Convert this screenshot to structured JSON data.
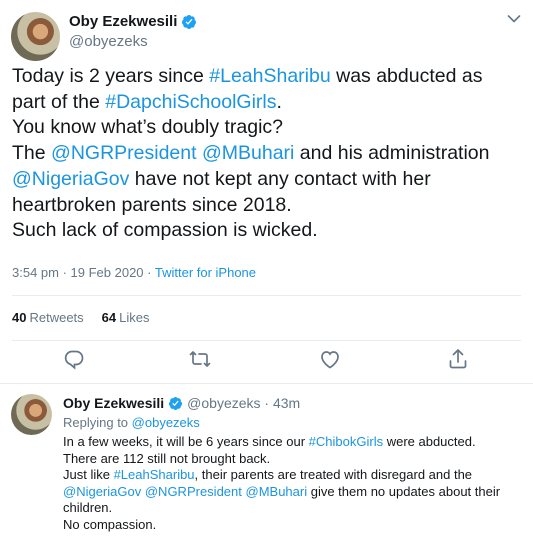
{
  "tweet": {
    "display_name": "Oby Ezekwesili",
    "handle": "@obyezeks",
    "body": {
      "l1_a": "Today is 2 years since ",
      "l1_link": "#LeahSharibu",
      "l1_b": " was abducted as",
      "l2_a": "part of the ",
      "l2_link": "#DapchiSchoolGirls",
      "l2_b": ".",
      "l3": "You know what’s doubly tragic?",
      "l4_a": "The ",
      "l4_link1": "@NGRPresident",
      "l4_sp": " ",
      "l4_link2": "@MBuhari",
      "l4_b": " and his administration",
      "l5_link": "@NigeriaGov",
      "l5_b": " have not kept any contact with her",
      "l6": "heartbroken parents since 2018.",
      "l7": "Such lack of compassion is wicked."
    },
    "time": "3:54 pm · 19 Feb 2020 · ",
    "source": "Twitter for iPhone",
    "retweets_count": "40",
    "retweets_label": "Retweets",
    "likes_count": "64",
    "likes_label": "Likes"
  },
  "reply": {
    "display_name": "Oby Ezekwesili",
    "handle_time": "@obyezeks · 43m",
    "replying_prefix": "Replying to ",
    "replying_to": "@obyezeks",
    "l1_a": "In a few weeks, it will be 6 years since our ",
    "l1_link": "#ChibokGirls",
    "l1_b": " were abducted.",
    "l2": "There are 112 still not brought back.",
    "l3_a": "Just like ",
    "l3_link": "#LeahSharibu",
    "l3_b": ", their parents are treated with disregard and the",
    "l4_link1": "@NigeriaGov",
    "l4_sp1": " ",
    "l4_link2": "@NGRPresident",
    "l4_sp2": " ",
    "l4_link3": "@MBuhari",
    "l4_b": " give them no updates about their",
    "l5": "children.",
    "l6": "No compassion."
  },
  "colors": {
    "link": "#1b95e0",
    "verified": "#1da1f2",
    "muted": "#657786"
  },
  "icons": [
    "verified-icon",
    "chevron-down-icon",
    "reply-icon",
    "retweet-icon",
    "like-icon",
    "share-icon"
  ]
}
